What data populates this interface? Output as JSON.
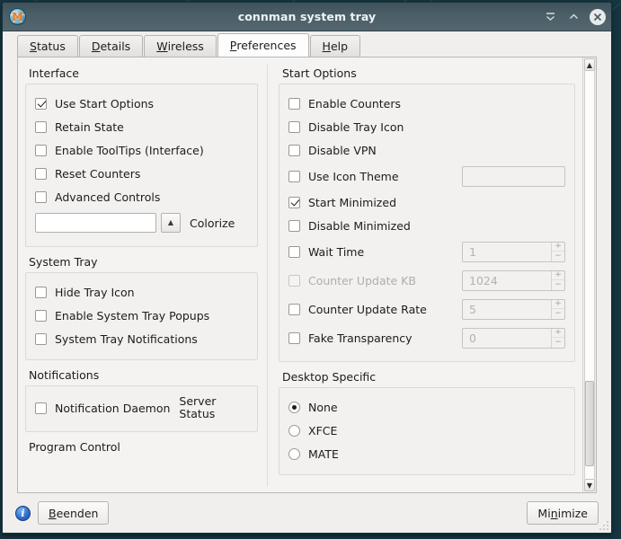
{
  "window": {
    "title": "connman system tray",
    "app_icon": "globe-m-icon",
    "icon_letter": "M",
    "controls": [
      {
        "name": "shade-button",
        "glyph": "shade"
      },
      {
        "name": "maximize-button",
        "glyph": "caret-up"
      },
      {
        "name": "close-button",
        "glyph": "x"
      }
    ]
  },
  "tabs": [
    {
      "label": "Status",
      "mnemonic": "S",
      "rest": "tatus",
      "active": false
    },
    {
      "label": "Details",
      "mnemonic": "D",
      "rest": "etails",
      "active": false
    },
    {
      "label": "Wireless",
      "mnemonic": "W",
      "rest": "ireless",
      "active": false
    },
    {
      "label": "Preferences",
      "mnemonic": "P",
      "rest": "references",
      "active": true
    },
    {
      "label": "Help",
      "mnemonic": "H",
      "rest": "elp",
      "active": false
    }
  ],
  "left_pane": {
    "interface": {
      "title": "Interface",
      "items": [
        {
          "label": "Use Start Options",
          "checked": true,
          "enabled": true
        },
        {
          "label": "Retain State",
          "checked": false,
          "enabled": true
        },
        {
          "label": "Enable ToolTips (Interface)",
          "checked": false,
          "enabled": true
        },
        {
          "label": "Reset Counters",
          "checked": false,
          "enabled": true
        },
        {
          "label": "Advanced Controls",
          "checked": false,
          "enabled": true
        }
      ],
      "colorize": {
        "entry_value": "",
        "stepper": "up-arrow",
        "label": "Colorize"
      }
    },
    "system_tray": {
      "title": "System Tray",
      "items": [
        {
          "label": "Hide Tray Icon",
          "checked": false,
          "enabled": true
        },
        {
          "label": "Enable System Tray Popups",
          "checked": false,
          "enabled": true
        },
        {
          "label": "System Tray Notifications",
          "checked": false,
          "enabled": true
        }
      ]
    },
    "notifications": {
      "title": "Notifications",
      "items": [
        {
          "label": "Notification Daemon",
          "checked": false,
          "enabled": true
        }
      ],
      "server_status_label": "Server Status"
    },
    "program_control": {
      "title": "Program Control"
    }
  },
  "right_pane": {
    "start_options": {
      "title": "Start Options",
      "items": [
        {
          "label": "Enable Counters",
          "checked": false,
          "enabled": true,
          "field": null
        },
        {
          "label": "Disable Tray Icon",
          "checked": false,
          "enabled": true,
          "field": null
        },
        {
          "label": "Disable VPN",
          "checked": false,
          "enabled": true,
          "field": null
        },
        {
          "label": "Use Icon Theme",
          "checked": false,
          "enabled": true,
          "field": {
            "type": "entry",
            "value": ""
          }
        },
        {
          "label": "Start Minimized",
          "checked": true,
          "enabled": true,
          "field": null
        },
        {
          "label": "Disable Minimized",
          "checked": false,
          "enabled": true,
          "field": null
        },
        {
          "label": "Wait Time",
          "checked": false,
          "enabled": true,
          "field": {
            "type": "spin",
            "value": "1"
          }
        },
        {
          "label": "Counter Update KB",
          "checked": false,
          "enabled": false,
          "field": {
            "type": "spin",
            "value": "1024"
          }
        },
        {
          "label": "Counter Update Rate",
          "checked": false,
          "enabled": true,
          "field": {
            "type": "spin",
            "value": "5"
          }
        },
        {
          "label": "Fake Transparency",
          "checked": false,
          "enabled": true,
          "field": {
            "type": "spin",
            "value": "0"
          }
        }
      ]
    },
    "desktop_specific": {
      "title": "Desktop Specific",
      "options": [
        {
          "label": "None",
          "selected": true
        },
        {
          "label": "XFCE",
          "selected": false
        },
        {
          "label": "MATE",
          "selected": false
        }
      ]
    }
  },
  "scrollbar": {
    "up_arrow": "▲",
    "down_arrow": "▼"
  },
  "statusbar": {
    "info_icon": "info-icon",
    "info_glyph": "i",
    "quit_button": {
      "mnemonic": "B",
      "rest": "eenden"
    },
    "minimize_button": {
      "pre": "Mi",
      "mnemonic": "n",
      "rest": "imize"
    }
  }
}
